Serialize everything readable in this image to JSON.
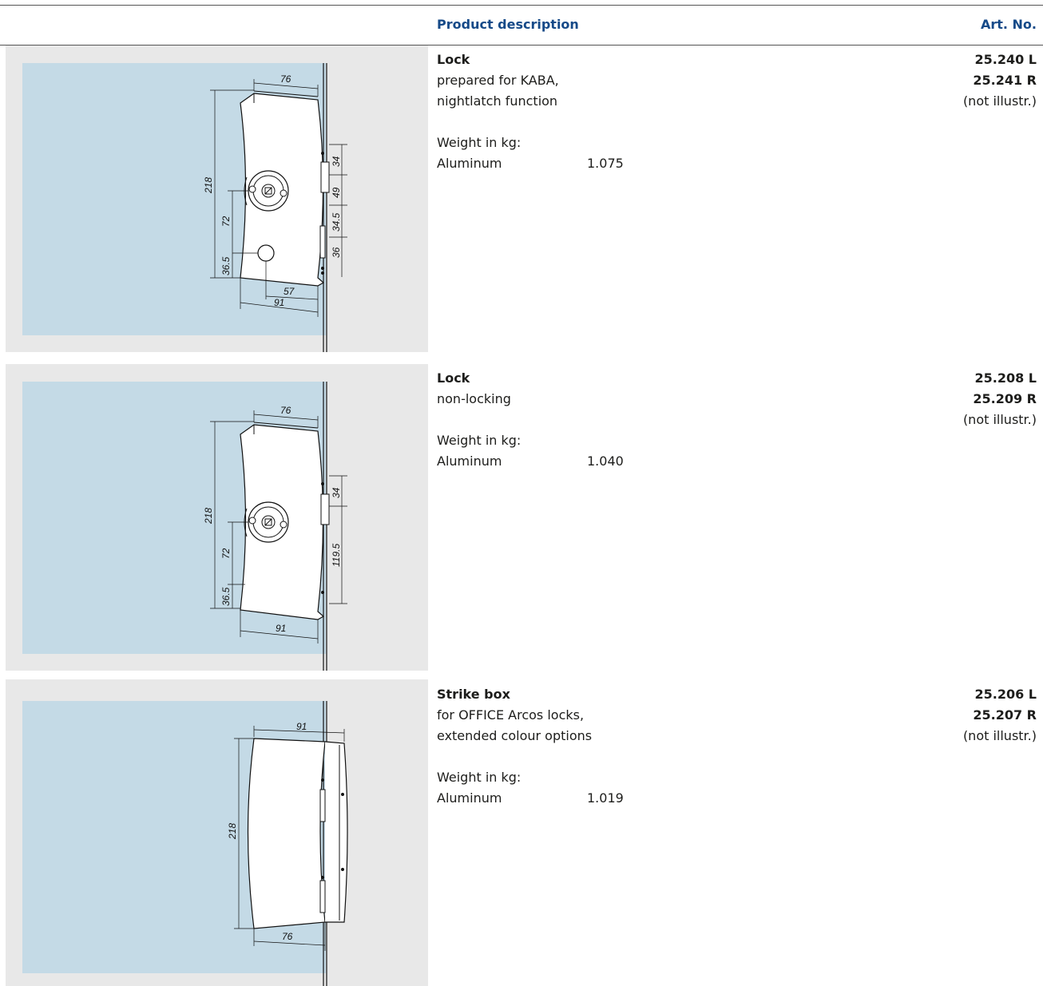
{
  "header": {
    "description": "Product description",
    "art_no": "Art. No."
  },
  "products": [
    {
      "title": "Lock",
      "lines": [
        "prepared for KABA,",
        "nightlatch function"
      ],
      "weight_label": "Weight in kg:",
      "material": "Aluminum",
      "weight": "1.075",
      "codes": [
        "25.240 L",
        "25.241 R"
      ],
      "note": "(not illustr.)",
      "dims": {
        "top": "76",
        "height": "218",
        "mid": "72",
        "low": "36.5",
        "bottom1": "57",
        "bottom2": "91",
        "r1": "34",
        "r2": "49",
        "r3": "34.5",
        "r4": "36"
      }
    },
    {
      "title": "Lock",
      "lines": [
        "non-locking"
      ],
      "weight_label": "Weight in kg:",
      "material": "Aluminum",
      "weight": "1.040",
      "codes": [
        "25.208 L",
        "25.209 R"
      ],
      "note": "(not illustr.)",
      "dims": {
        "top": "76",
        "height": "218",
        "mid": "72",
        "low": "36.5",
        "bottom": "91",
        "r1": "34",
        "r2": "119.5"
      }
    },
    {
      "title": "Strike box",
      "lines": [
        "for OFFICE Arcos locks,",
        "extended colour options"
      ],
      "weight_label": "Weight in kg:",
      "material": "Aluminum",
      "weight": "1.019",
      "codes": [
        "25.206 L",
        "25.207 R"
      ],
      "note": "(not illustr.)",
      "dims": {
        "top": "91",
        "height": "218",
        "bottom": "76"
      }
    }
  ],
  "colors": {
    "glass": "#c4dae6",
    "panel": "#e8e8e8",
    "header": "#164a88"
  }
}
